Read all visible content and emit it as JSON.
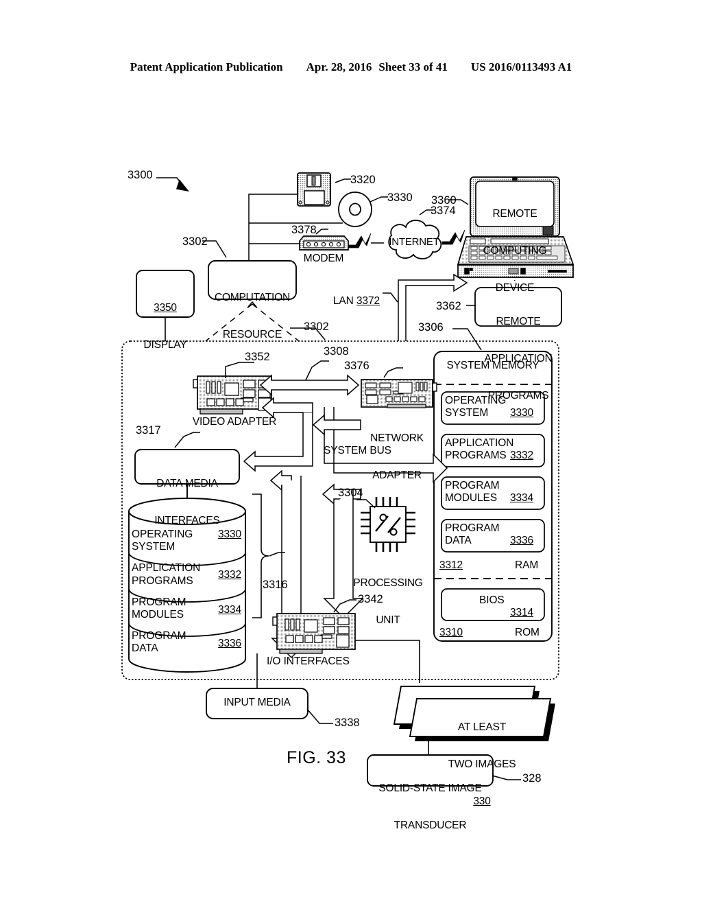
{
  "header": {
    "publication": "Patent Application Publication",
    "date": "Apr. 28, 2016",
    "sheet": "Sheet 33 of 41",
    "docnum": "US 2016/0113493 A1"
  },
  "figure": {
    "label": "FIG. 33",
    "system_ref": "3300"
  },
  "nodes": {
    "computation_resource": {
      "label_line1": "COMPUTATION",
      "label_line2": "RESOURCE",
      "ref": "3302"
    },
    "display": {
      "ref": "3350",
      "label": "DISPLAY"
    },
    "floppy": {
      "ref": "3320",
      "name": "floppy-disk-icon"
    },
    "optical_disc": {
      "ref": "3330",
      "name": "optical-disc-icon"
    },
    "modem": {
      "label": "MODEM",
      "ref": "3378"
    },
    "internet": {
      "label": "INTERNET",
      "ref": "3374"
    },
    "remote_device": {
      "line1": "REMOTE",
      "line2": "COMPUTING",
      "line3": "DEVICE",
      "ref": "3360"
    },
    "remote_app_programs": {
      "line1": "REMOTE",
      "line2": "APPLICATION",
      "line3": "PROGRAMS",
      "ref": "3362"
    },
    "lan": {
      "label": "LAN",
      "ref": "3372"
    },
    "main_enclosure": {
      "ref": "3302"
    },
    "video_adapter": {
      "label": "VIDEO ADAPTER",
      "ref": "3352"
    },
    "network_adapter": {
      "line1": "NETWORK",
      "line2": "ADAPTER",
      "ref": "3376"
    },
    "system_bus": {
      "label": "SYSTEM BUS",
      "ref": "3308"
    },
    "data_media_interfaces": {
      "line1": "DATA MEDIA",
      "line2": "INTERFACES",
      "ref": "3317"
    },
    "processing_unit": {
      "line1": "PROCESSING",
      "line2": "UNIT",
      "ref": "3304"
    },
    "io_interfaces": {
      "label": "I/O INTERFACES",
      "ref": "3342"
    },
    "input_media": {
      "label": "INPUT MEDIA",
      "ref": "3338"
    },
    "at_least_two_images": {
      "line1": "AT LEAST",
      "line2": "TWO IMAGES",
      "ref": "330"
    },
    "solid_state_transducer": {
      "line1": "SOLID-STATE IMAGE",
      "line2": "TRANSDUCER",
      "ref": "328"
    },
    "storage_bracket": {
      "ref": "3316"
    }
  },
  "system_memory": {
    "title": "SYSTEM MEMORY",
    "ref": "3306",
    "ram": {
      "ref": "3312",
      "label": "RAM"
    },
    "rom": {
      "ref": "3310",
      "label": "ROM"
    },
    "items": [
      {
        "line1": "OPERATING",
        "line2": "SYSTEM",
        "ref": "3330"
      },
      {
        "line1": "APPLICATION",
        "line2": "PROGRAMS",
        "ref": "3332"
      },
      {
        "line1": "PROGRAM",
        "line2": "MODULES",
        "ref": "3334"
      },
      {
        "line1": "PROGRAM",
        "line2": "DATA",
        "ref": "3336"
      }
    ],
    "bios": {
      "label": "BIOS",
      "ref": "3314"
    }
  },
  "disk_store": {
    "items": [
      {
        "line1": "OPERATING",
        "line2": "SYSTEM",
        "ref": "3330"
      },
      {
        "line1": "APPLICATION",
        "line2": "PROGRAMS",
        "ref": "3332"
      },
      {
        "line1": "PROGRAM",
        "line2": "MODULES",
        "ref": "3334"
      },
      {
        "line1": "PROGRAM",
        "line2": "DATA",
        "ref": "3336"
      }
    ]
  },
  "colors": {
    "ink": "#000000",
    "paper": "#ffffff",
    "shade": "#d8d8d8"
  }
}
